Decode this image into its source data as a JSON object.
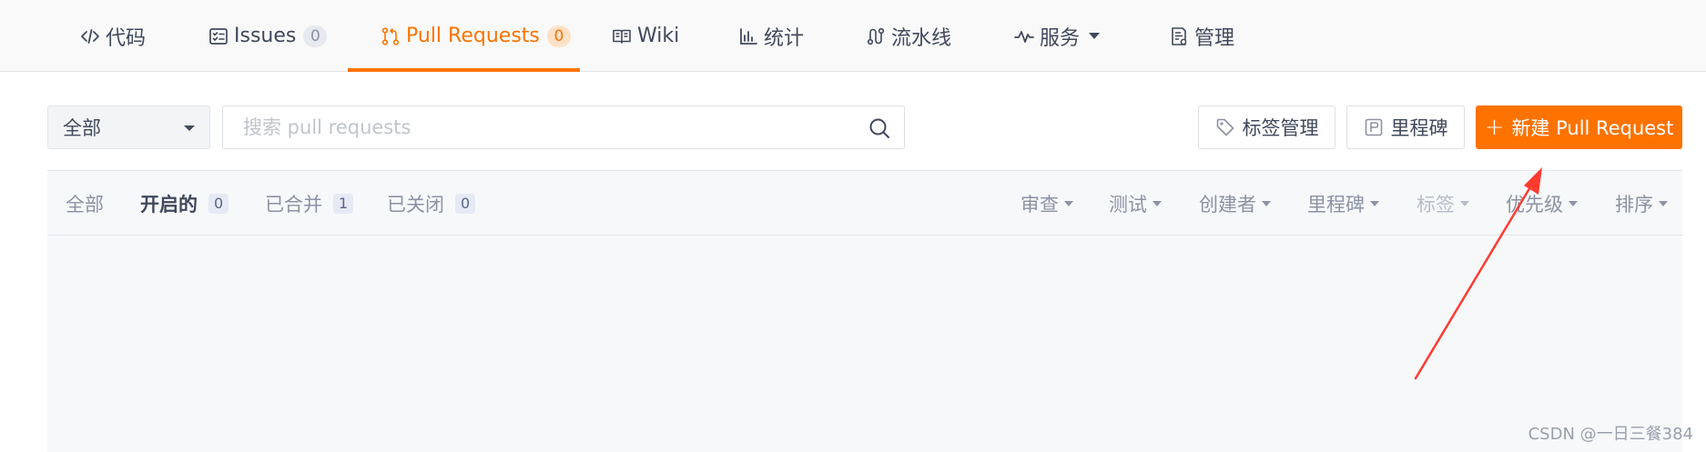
{
  "tabs": [
    {
      "label": "代码",
      "icon": "code-icon"
    },
    {
      "label": "Issues",
      "icon": "issues-icon",
      "count": "0"
    },
    {
      "label": "Pull Requests",
      "icon": "pull-request-icon",
      "count": "0",
      "active": true
    },
    {
      "label": "Wiki",
      "icon": "book-icon"
    },
    {
      "label": "统计",
      "icon": "bar-chart-icon"
    },
    {
      "label": "流水线",
      "icon": "pipeline-icon"
    },
    {
      "label": "服务",
      "icon": "pulse-icon"
    },
    {
      "label": "管理",
      "icon": "settings-doc-icon"
    }
  ],
  "toolbar": {
    "filter_select": "全部",
    "search_placeholder": "搜索 pull requests",
    "labels_button": "标签管理",
    "milestones_button": "里程碑",
    "new_pr_button": "新建 Pull Request"
  },
  "states": [
    {
      "label": "全部"
    },
    {
      "label": "开启的",
      "count": "0",
      "active": true
    },
    {
      "label": "已合并",
      "count": "1"
    },
    {
      "label": "已关闭",
      "count": "0"
    }
  ],
  "filters": [
    {
      "label": "审查"
    },
    {
      "label": "测试"
    },
    {
      "label": "创建者"
    },
    {
      "label": "里程碑"
    },
    {
      "label": "标签",
      "disabled": true
    },
    {
      "label": "优先级"
    },
    {
      "label": "排序"
    }
  ],
  "watermark": "CSDN @一日三餐384",
  "colors": {
    "accent": "#fe7300",
    "annotation_arrow": "#ff3b30"
  }
}
